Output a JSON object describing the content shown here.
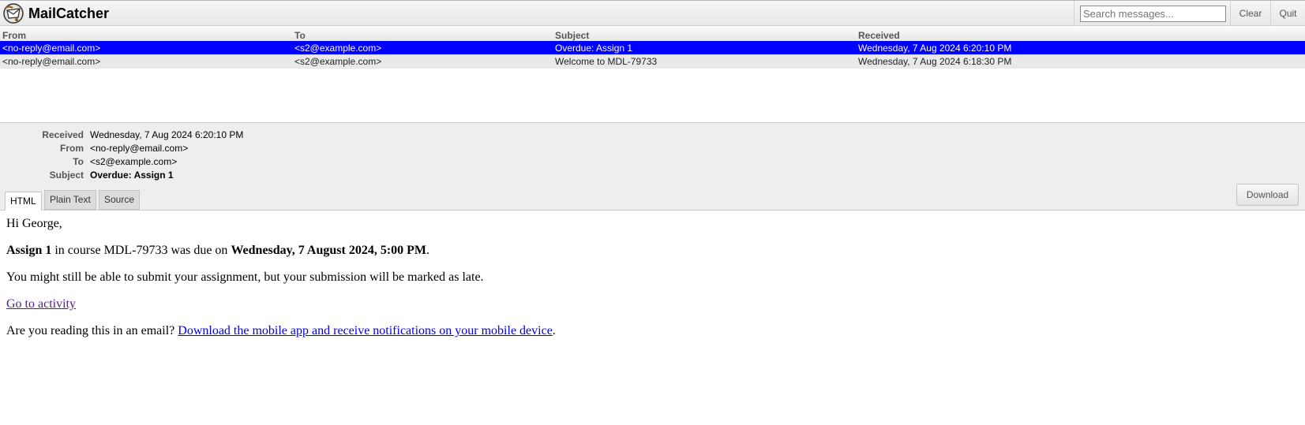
{
  "app": {
    "title": "MailCatcher"
  },
  "search": {
    "placeholder": "Search messages..."
  },
  "header": {
    "clear_label": "Clear",
    "quit_label": "Quit"
  },
  "table": {
    "columns": [
      "From",
      "To",
      "Subject",
      "Received"
    ],
    "rows": [
      {
        "from": "<no-reply@email.com>",
        "to": "<s2@example.com>",
        "subject": "Overdue: Assign 1",
        "received": "Wednesday, 7 Aug 2024 6:20:10 PM",
        "selected": true
      },
      {
        "from": "<no-reply@email.com>",
        "to": "<s2@example.com>",
        "subject": "Welcome to MDL-79733",
        "received": "Wednesday, 7 Aug 2024 6:18:30 PM",
        "selected": false
      }
    ]
  },
  "detail": {
    "labels": {
      "received": "Received",
      "from": "From",
      "to": "To",
      "subject": "Subject"
    },
    "received": "Wednesday, 7 Aug 2024 6:20:10 PM",
    "from": "<no-reply@email.com>",
    "to": "<s2@example.com>",
    "subject": "Overdue: Assign 1",
    "tabs": {
      "html": "HTML",
      "plain": "Plain Text",
      "source": "Source"
    },
    "download_label": "Download"
  },
  "email": {
    "greeting": "Hi George,",
    "assignment": "Assign 1",
    "course_text": " in course MDL-79733 was due on ",
    "due_date": "Wednesday, 7 August 2024, 5:00 PM",
    "period": ".",
    "late_text": "You might still be able to submit your assignment, but your submission will be marked as late.",
    "activity_link": "Go to activity",
    "reading_text": "Are you reading this in an email? ",
    "mobile_link": "Download the mobile app and receive notifications on your mobile device",
    "period2": "."
  },
  "colors": {
    "selected_row": "#0000ff",
    "link": "#0000ee",
    "visited_link": "#551a8b"
  }
}
